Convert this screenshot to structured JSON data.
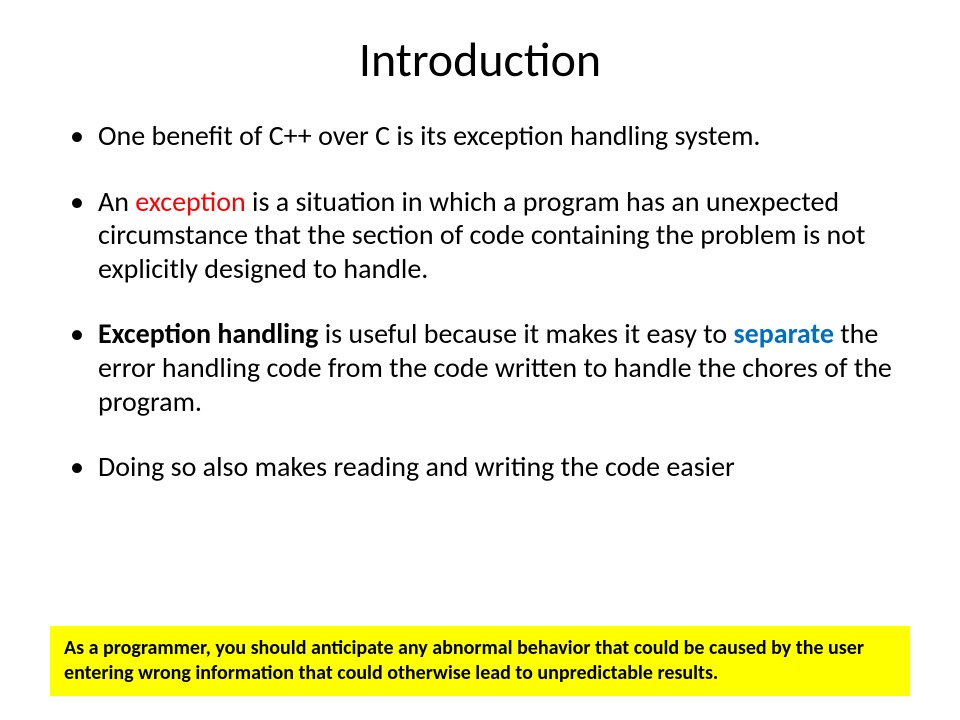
{
  "title": "Introduction",
  "bullets": {
    "b1": "One benefit of C++ over C is its exception handling system.",
    "b2_pre": "An ",
    "b2_red": "exception",
    "b2_post": " is a situation in which a program has an unexpected circumstance that the section of code containing the problem is not explicitly designed to handle.",
    "b3_bold": "Exception handling",
    "b3_mid": " is useful because it makes it easy to ",
    "b3_blue": "separate",
    "b3_post": " the error handling code from the code written to handle the chores of the program.",
    "b4": "Doing so also makes reading and writing the code easier"
  },
  "callout": "As a programmer, you should anticipate any abnormal behavior that could be caused by the user entering wrong information that could otherwise lead to unpredictable results."
}
